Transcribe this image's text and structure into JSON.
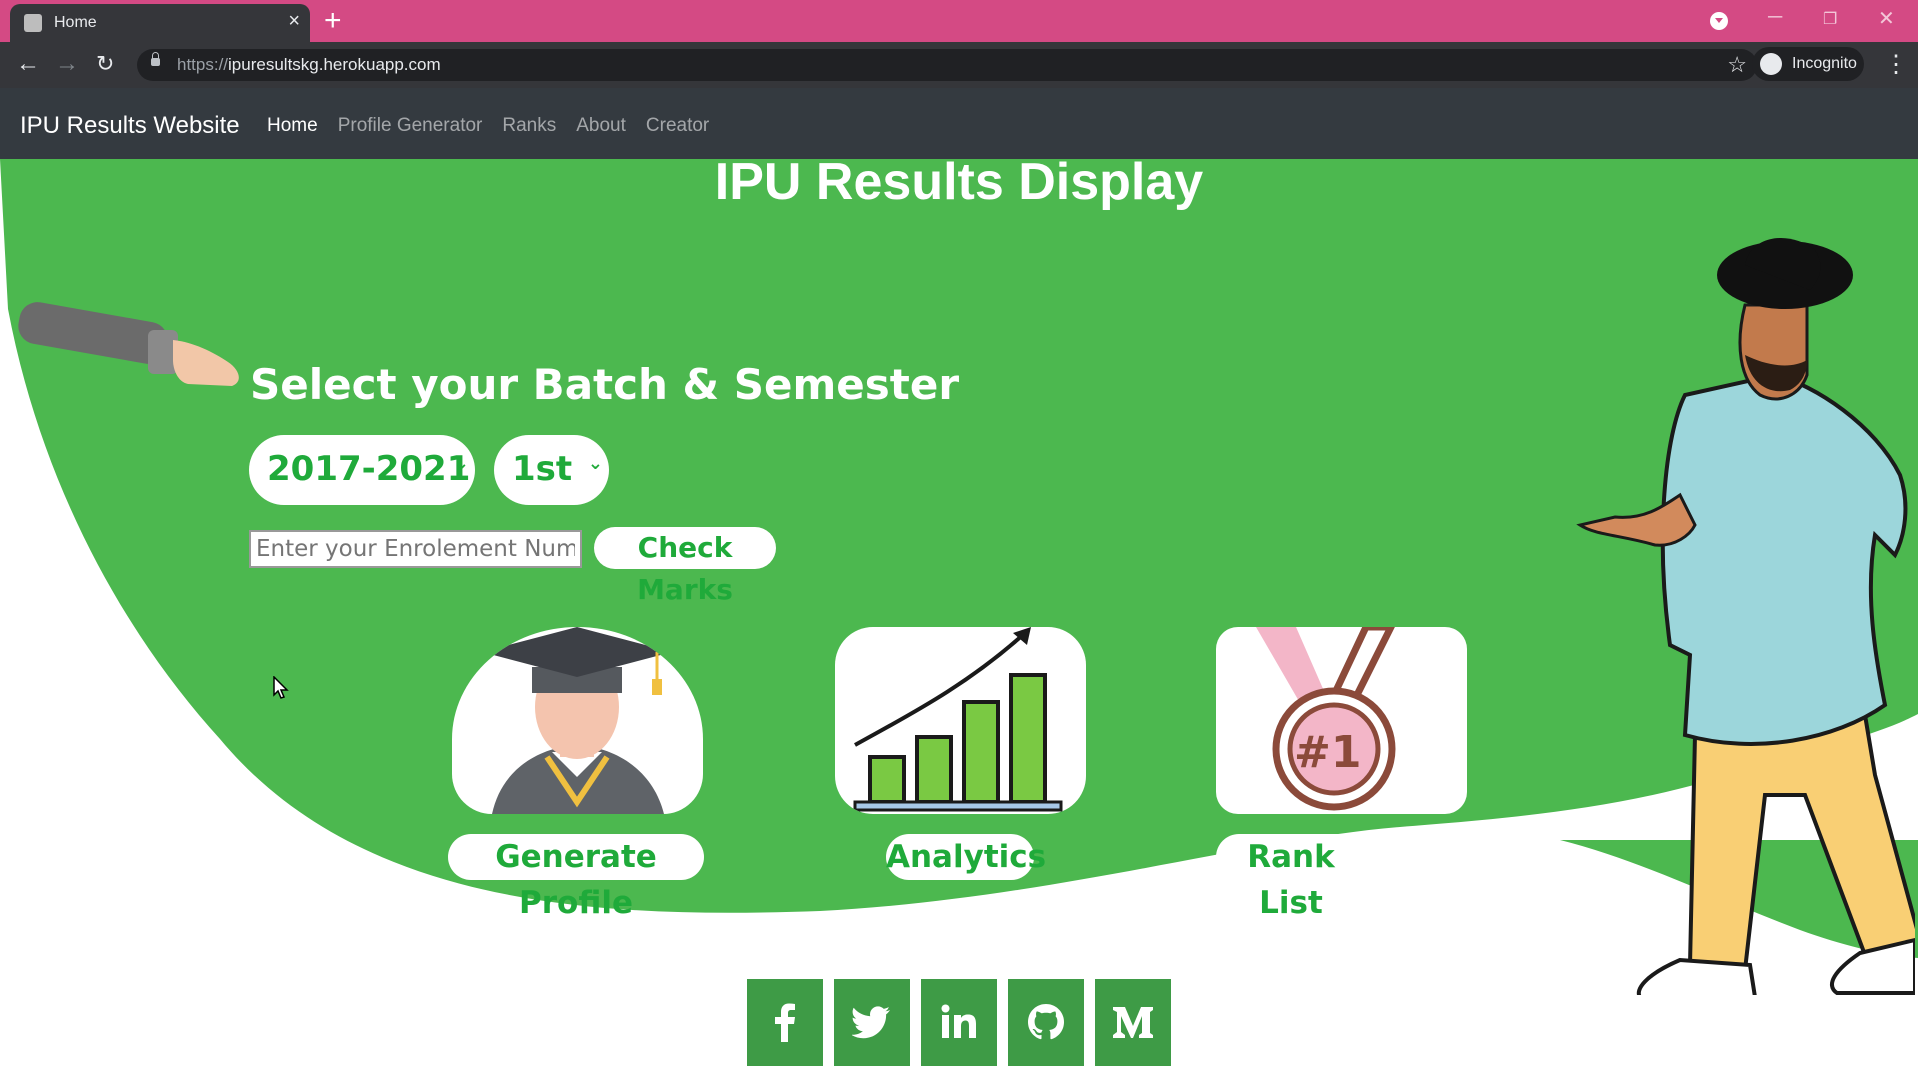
{
  "browser": {
    "tab_title": "Home",
    "url_prefix": "https://",
    "url_host": "ipuresultskg.herokuapp.com",
    "profile_label": "Incognito"
  },
  "navbar": {
    "brand": "IPU Results Website",
    "links": [
      "Home",
      "Profile Generator",
      "Ranks",
      "About",
      "Creator"
    ],
    "active": "Home"
  },
  "hero": {
    "title": "IPU Results Display",
    "select_heading": "Select your Batch & Semester",
    "batch_value": "2017-2021",
    "semester_value": "1st",
    "enrolment_placeholder": "Enter your Enrolement Number",
    "check_button": "Check Marks"
  },
  "cards": {
    "profile_label": "Generate Profile",
    "analytics_label": "Analytics",
    "rank_label": "Rank List",
    "rank_badge_text": "#1"
  },
  "social": {
    "icons": [
      "facebook-icon",
      "twitter-icon",
      "linkedin-icon",
      "github-icon",
      "medium-icon"
    ]
  },
  "colors": {
    "brand_green": "#4cb84f",
    "label_green": "#1faa3a",
    "social_green": "#3e9b46",
    "navbar": "#343a40",
    "tabstrip": "#d44a84"
  }
}
